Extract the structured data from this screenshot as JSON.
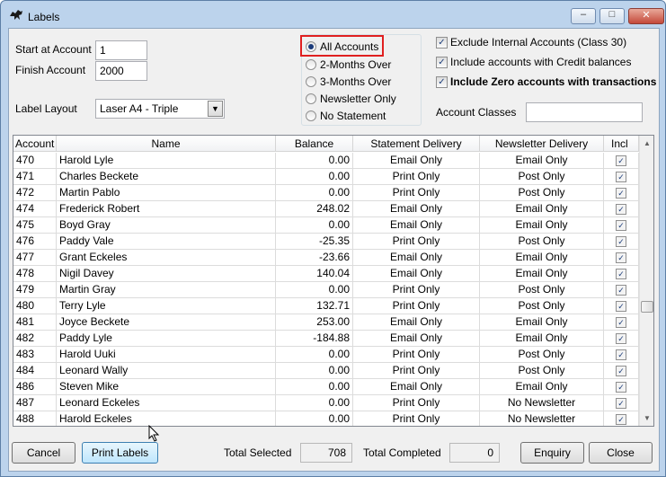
{
  "window": {
    "title": "Labels",
    "min": "–",
    "max": "□",
    "close": "✕",
    "icon": "panther-icon"
  },
  "filters": {
    "start_label": "Start at Account",
    "start_value": "1",
    "finish_label": "Finish Account",
    "finish_value": "2000",
    "layout_label": "Label Layout",
    "layout_value": "Laser A4 - Triple"
  },
  "statement_options": [
    "All Accounts",
    "2-Months Over",
    "3-Months Over",
    "Newsletter Only",
    "No Statement"
  ],
  "statement_selected": "All Accounts",
  "options": [
    {
      "label": "Exclude Internal Accounts (Class 30)",
      "checked": true,
      "bold": false
    },
    {
      "label": "Include accounts with Credit balances",
      "checked": true,
      "bold": false
    },
    {
      "label": "Include Zero accounts with transactions",
      "checked": true,
      "bold": true
    }
  ],
  "account_classes_label": "Account Classes",
  "account_classes_value": "",
  "columns": [
    "Account",
    "Name",
    "Balance",
    "Statement Delivery",
    "Newsletter Delivery",
    "Incl"
  ],
  "rows": [
    {
      "account": "470",
      "name": "Harold Lyle",
      "balance": "0.00",
      "statement": "Email Only",
      "newsletter": "Email Only",
      "incl": true
    },
    {
      "account": "471",
      "name": "Charles Beckete",
      "balance": "0.00",
      "statement": "Print Only",
      "newsletter": "Post Only",
      "incl": true
    },
    {
      "account": "472",
      "name": "Martin Pablo",
      "balance": "0.00",
      "statement": "Print Only",
      "newsletter": "Post Only",
      "incl": true
    },
    {
      "account": "474",
      "name": "Frederick Robert",
      "balance": "248.02",
      "statement": "Email Only",
      "newsletter": "Email Only",
      "incl": true
    },
    {
      "account": "475",
      "name": "Boyd Gray",
      "balance": "0.00",
      "statement": "Email Only",
      "newsletter": "Email Only",
      "incl": true
    },
    {
      "account": "476",
      "name": "Paddy Vale",
      "balance": "-25.35",
      "statement": "Print Only",
      "newsletter": "Post Only",
      "incl": true
    },
    {
      "account": "477",
      "name": "Grant Eckeles",
      "balance": "-23.66",
      "statement": "Email Only",
      "newsletter": "Email Only",
      "incl": true
    },
    {
      "account": "478",
      "name": "Nigil Davey",
      "balance": "140.04",
      "statement": "Email Only",
      "newsletter": "Email Only",
      "incl": true
    },
    {
      "account": "479",
      "name": "Martin Gray",
      "balance": "0.00",
      "statement": "Print Only",
      "newsletter": "Post Only",
      "incl": true
    },
    {
      "account": "480",
      "name": "Terry Lyle",
      "balance": "132.71",
      "statement": "Print Only",
      "newsletter": "Post Only",
      "incl": true
    },
    {
      "account": "481",
      "name": "Joyce Beckete",
      "balance": "253.00",
      "statement": "Email Only",
      "newsletter": "Email Only",
      "incl": true
    },
    {
      "account": "482",
      "name": "Paddy Lyle",
      "balance": "-184.88",
      "statement": "Email Only",
      "newsletter": "Email Only",
      "incl": true
    },
    {
      "account": "483",
      "name": "Harold Uuki",
      "balance": "0.00",
      "statement": "Print Only",
      "newsletter": "Post Only",
      "incl": true
    },
    {
      "account": "484",
      "name": "Leonard Wally",
      "balance": "0.00",
      "statement": "Print Only",
      "newsletter": "Post Only",
      "incl": true
    },
    {
      "account": "486",
      "name": "Steven Mike",
      "balance": "0.00",
      "statement": "Email Only",
      "newsletter": "Email Only",
      "incl": true
    },
    {
      "account": "487",
      "name": "Leonard Eckeles",
      "balance": "0.00",
      "statement": "Print Only",
      "newsletter": "No Newsletter",
      "incl": true
    },
    {
      "account": "488",
      "name": "Harold Eckeles",
      "balance": "0.00",
      "statement": "Print Only",
      "newsletter": "No Newsletter",
      "incl": true
    }
  ],
  "footer": {
    "cancel": "Cancel",
    "print": "Print Labels",
    "total_selected_label": "Total Selected",
    "total_selected": "708",
    "total_completed_label": "Total Completed",
    "total_completed": "0",
    "enquiry": "Enquiry",
    "close": "Close"
  },
  "colors": {
    "highlight": "#e02020",
    "titlebar": "#bcd3ec",
    "focus": "#bee6fd"
  }
}
